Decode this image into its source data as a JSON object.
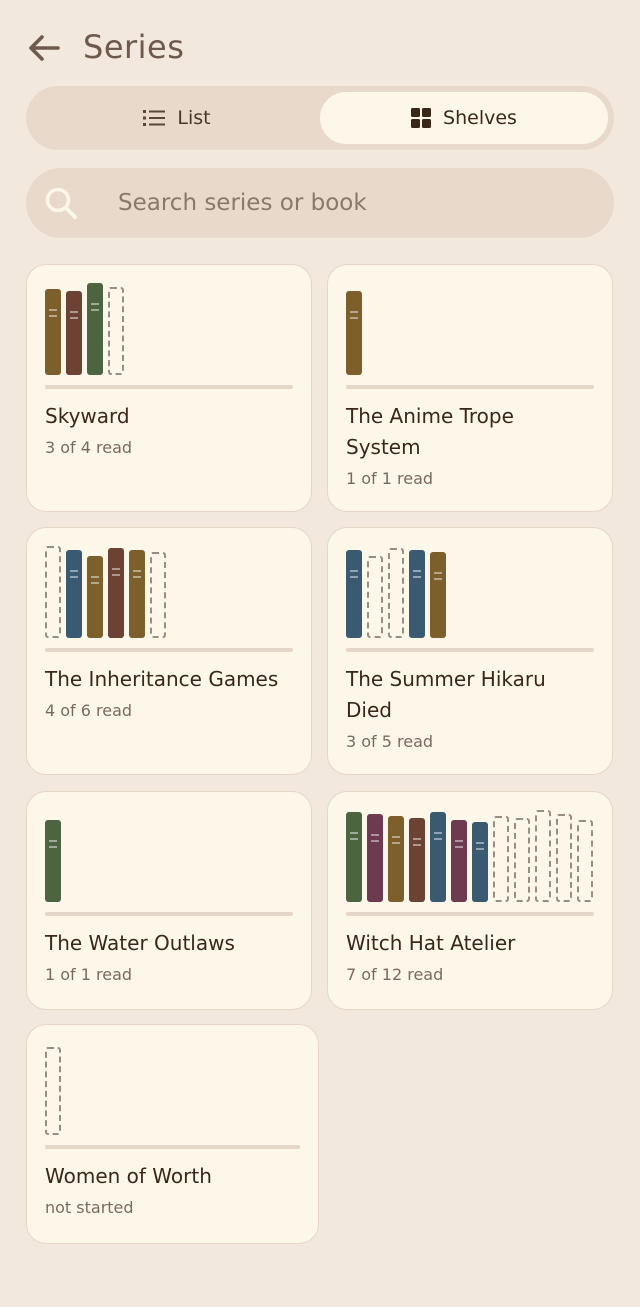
{
  "header": {
    "title": "Series"
  },
  "view_toggle": {
    "list_label": "List",
    "shelves_label": "Shelves",
    "selected": "Shelves"
  },
  "search": {
    "placeholder": "Search series or book",
    "value": ""
  },
  "colors": {
    "olive": "#7d5f2b",
    "brown": "#6b4233",
    "green": "#4d6440",
    "blue": "#3a5a72",
    "plum": "#6e3a52",
    "background": "#f2e8de",
    "card": "#fdf7ea",
    "pill": "#e8d9cb"
  },
  "series": [
    {
      "title": "Skyward",
      "subtitle": "3 of 4 read",
      "books": [
        {
          "c": "olive",
          "read": true
        },
        {
          "c": "brown",
          "read": true
        },
        {
          "c": "green",
          "read": true
        },
        {
          "c": "",
          "read": false
        }
      ]
    },
    {
      "title": "The Anime Trope System",
      "subtitle": "1 of 1 read",
      "books": [
        {
          "c": "olive",
          "read": true
        }
      ]
    },
    {
      "title": "The Inheritance Games",
      "subtitle": "4 of 6 read",
      "books": [
        {
          "c": "",
          "read": false
        },
        {
          "c": "blue",
          "read": true
        },
        {
          "c": "olive",
          "read": true
        },
        {
          "c": "brown",
          "read": true
        },
        {
          "c": "olive",
          "read": true
        },
        {
          "c": "",
          "read": false
        }
      ]
    },
    {
      "title": "The Summer Hikaru Died",
      "subtitle": "3 of 5 read",
      "books": [
        {
          "c": "blue",
          "read": true
        },
        {
          "c": "",
          "read": false
        },
        {
          "c": "",
          "read": false
        },
        {
          "c": "blue",
          "read": true
        },
        {
          "c": "olive",
          "read": true
        }
      ]
    },
    {
      "title": "The Water Outlaws",
      "subtitle": "1 of 1 read",
      "books": [
        {
          "c": "green",
          "read": true
        }
      ]
    },
    {
      "title": "Witch Hat Atelier",
      "subtitle": "7 of 12 read",
      "books": [
        {
          "c": "green",
          "read": true
        },
        {
          "c": "plum",
          "read": true
        },
        {
          "c": "olive",
          "read": true
        },
        {
          "c": "brown",
          "read": true
        },
        {
          "c": "blue",
          "read": true
        },
        {
          "c": "plum",
          "read": true
        },
        {
          "c": "blue",
          "read": true
        },
        {
          "c": "",
          "read": false
        },
        {
          "c": "",
          "read": false
        },
        {
          "c": "",
          "read": false
        },
        {
          "c": "",
          "read": false
        },
        {
          "c": "",
          "read": false
        }
      ]
    },
    {
      "title": "Women of Worth",
      "subtitle": "not started",
      "books": [
        {
          "c": "",
          "read": false
        }
      ]
    }
  ]
}
